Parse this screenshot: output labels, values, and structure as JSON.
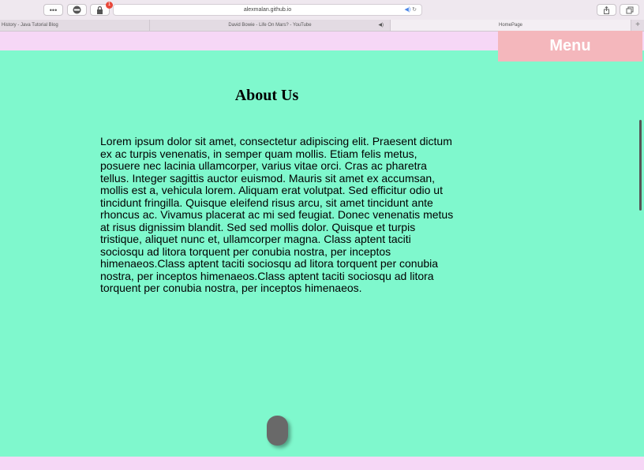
{
  "browser": {
    "toolbar": {
      "more_label": "•••",
      "badge_count": "1",
      "url": "alexmalan.github.io",
      "audio_icon": "speaker-icon",
      "reload_icon": "reload-icon"
    },
    "tabs": [
      {
        "label": "History - Java Tutorial Blog",
        "active": false
      },
      {
        "label": "David Bowie - Life On Mars? - YouTube",
        "active": false
      },
      {
        "label": "HomePage",
        "active": true
      }
    ],
    "new_tab_label": "+"
  },
  "page": {
    "menu_label": "Menu",
    "heading": "About Us",
    "paragraph": "Lorem ipsum dolor sit amet, consectetur adipiscing elit. Praesent dictum ex ac turpis venenatis, in semper quam mollis. Etiam felis metus, posuere nec lacinia ullamcorper, varius vitae orci. Cras ac pharetra tellus. Integer sagittis auctor euismod. Mauris sit amet ex accumsan, mollis est a, vehicula lorem. Aliquam erat volutpat. Sed efficitur odio ut tincidunt fringilla. Quisque eleifend risus arcu, sit amet tincidunt ante rhoncus ac. Vivamus placerat ac mi sed feugiat. Donec venenatis metus at risus dignissim blandit. Sed sed mollis dolor. Quisque et turpis tristique, aliquet nunc et, ullamcorper magna. Class aptent taciti sociosqu ad litora torquent per conubia nostra, per inceptos himenaeos.Class aptent taciti sociosqu ad litora torquent per conubia nostra, per inceptos himenaeos.Class aptent taciti sociosqu ad litora torquent per conubia nostra, per inceptos himenaeos."
  },
  "colors": {
    "content_bg": "#7ff8cd",
    "header_bg": "#f6d7f6",
    "menu_bg": "#f4b7bc"
  }
}
